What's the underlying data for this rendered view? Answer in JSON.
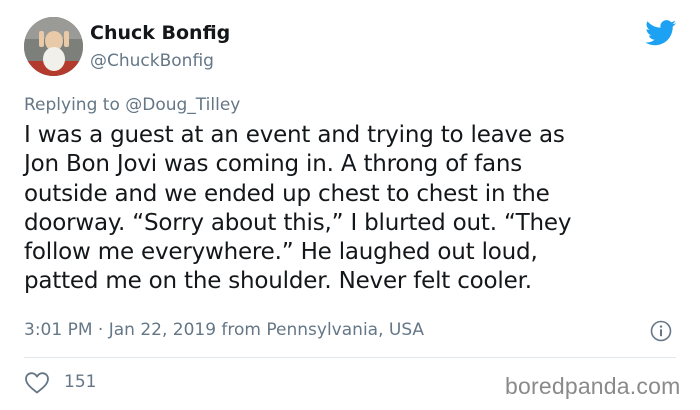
{
  "author": {
    "display_name": "Chuck Bonfig",
    "handle": "@ChuckBonfig"
  },
  "reply": {
    "prefix": "Replying to ",
    "mention": "@Doug_Tilley"
  },
  "tweet": {
    "lines": [
      "I was a guest at an event and trying to leave as",
      "Jon Bon Jovi was coming in. A throng of fans",
      "outside and we ended up chest to chest in the",
      "doorway. “Sorry about this,” I blurted out. “They",
      "follow me everywhere.” He laughed out loud,",
      "patted me on the shoulder. Never felt cooler."
    ]
  },
  "meta": {
    "timestamp": "3:01 PM · Jan 22, 2019 from Pennsylvania, USA"
  },
  "engagement": {
    "like_count": "151"
  },
  "watermark": "boredpanda.com",
  "colors": {
    "twitter_blue": "#1da1f2",
    "secondary_text": "#657786",
    "primary_text": "#14171a",
    "divider": "#e1e8ed"
  },
  "icons": {
    "brand": "twitter-bird-icon",
    "info": "info-icon",
    "like": "heart-icon"
  }
}
